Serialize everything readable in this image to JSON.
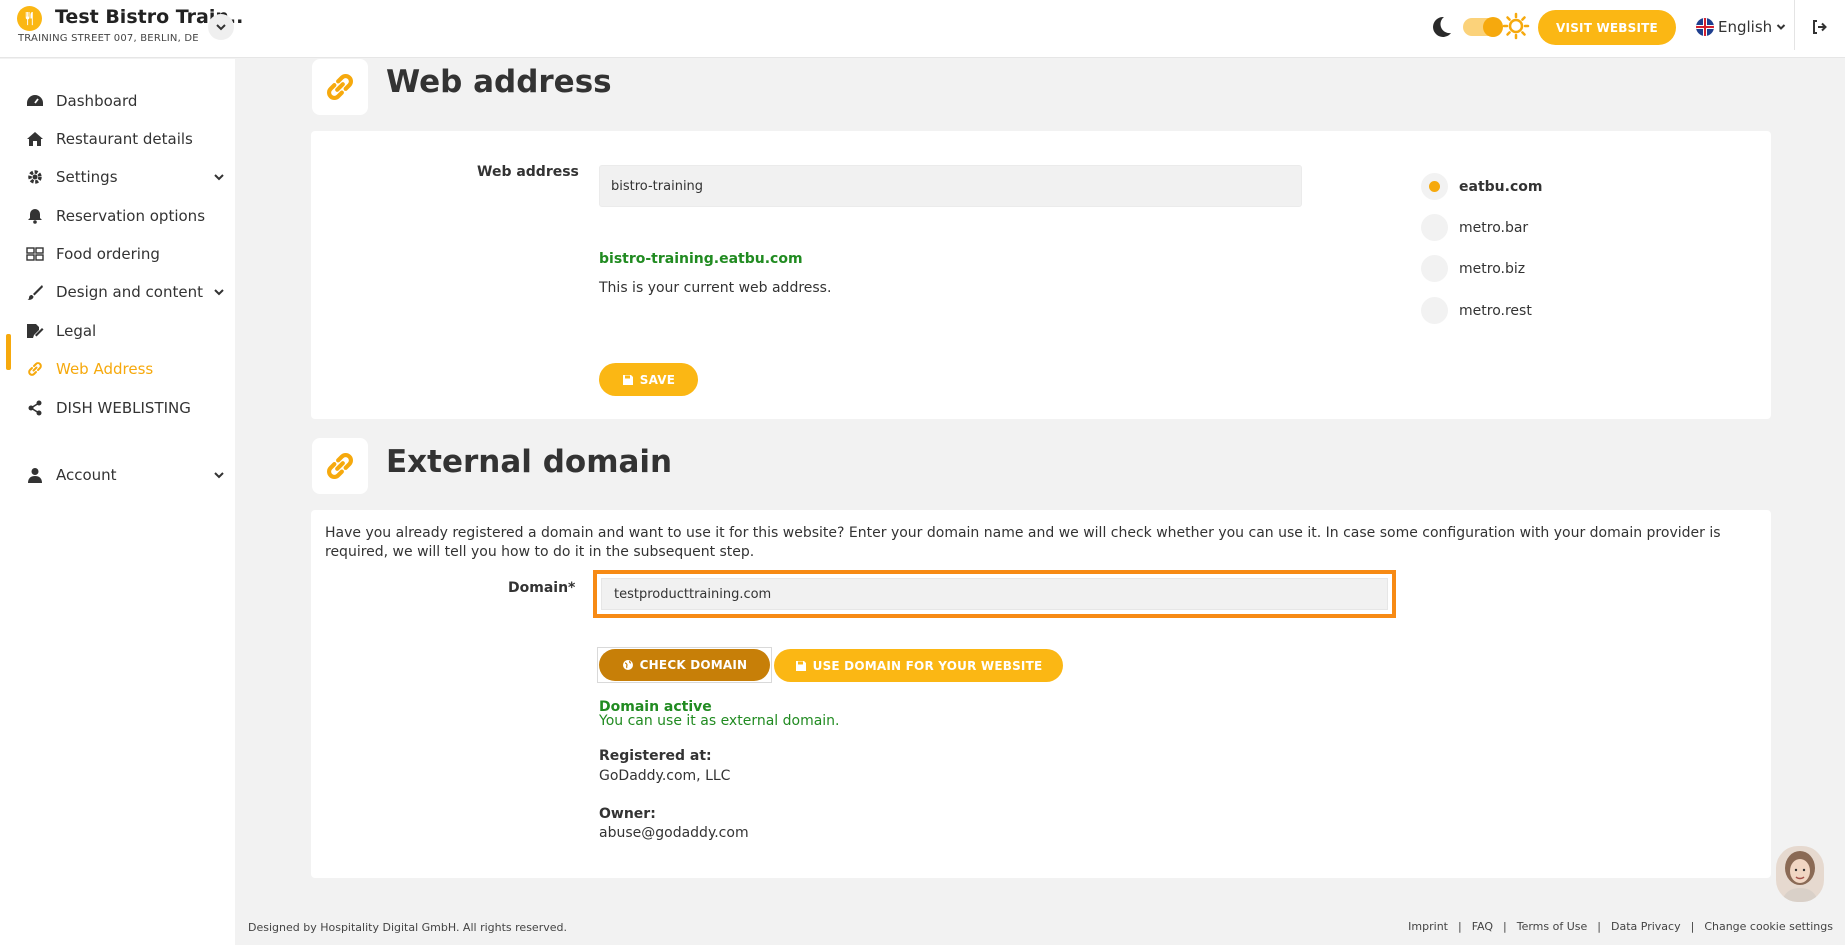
{
  "header": {
    "brand_title": "Test Bistro Train..",
    "brand_address": "TRAINING STREET 007, BERLIN, DE",
    "visit_label": "VISIT WEBSITE",
    "language": "English"
  },
  "sidebar": {
    "items": [
      {
        "label": "Dashboard",
        "icon": "dashboard-icon"
      },
      {
        "label": "Restaurant details",
        "icon": "home-icon"
      },
      {
        "label": "Settings",
        "icon": "gear-icon"
      },
      {
        "label": "Reservation options",
        "icon": "bell-icon"
      },
      {
        "label": "Food ordering",
        "icon": "food-ordering-icon"
      },
      {
        "label": "Design and content",
        "icon": "brush-icon"
      },
      {
        "label": "Legal",
        "icon": "legal-icon"
      },
      {
        "label": "Web Address",
        "icon": "link-icon"
      },
      {
        "label": "DISH WEBLISTING",
        "icon": "share-icon"
      },
      {
        "label": "Account",
        "icon": "user-icon"
      }
    ],
    "active": "Web Address"
  },
  "web_address": {
    "title": "Web address",
    "field_label": "Web address",
    "value": "bistro-training",
    "current_url": "bistro-training.eatbu.com",
    "current_note": "This is your current web address.",
    "save_label": "SAVE",
    "domains": [
      "eatbu.com",
      "metro.bar",
      "metro.biz",
      "metro.rest"
    ],
    "selected_domain": "eatbu.com"
  },
  "external_domain": {
    "title": "External domain",
    "description": "Have you already registered a domain and want to use it for this website? Enter your domain name and we will check whether you can use it. In case some configuration with your domain provider is required, we will tell you how to do it in the subsequent step.",
    "field_label": "Domain*",
    "value": "testproducttraining.com",
    "check_label": "CHECK DOMAIN",
    "use_label": "USE DOMAIN FOR YOUR WEBSITE",
    "status_title": "Domain active",
    "status_text": "You can use it as external domain.",
    "registered_label": "Registered at:",
    "registered_value": "GoDaddy.com, LLC",
    "owner_label": "Owner:",
    "owner_value": "abuse@godaddy.com"
  },
  "footer": {
    "copyright": "Designed by Hospitality Digital GmbH. All rights reserved.",
    "links": [
      "Imprint",
      "FAQ",
      "Terms of Use",
      "Data Privacy",
      "Change cookie settings"
    ]
  },
  "colors": {
    "accent": "#fbb714",
    "accent_dark": "#c77f08",
    "highlight": "#f78a14",
    "success": "#218b21"
  }
}
